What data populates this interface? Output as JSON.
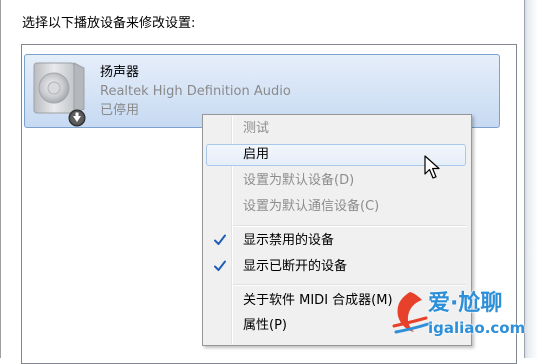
{
  "dialog": {
    "instruction": "选择以下播放设备来修改设置:"
  },
  "device": {
    "icon": "speaker-icon",
    "status_icon": "disabled-arrow-icon",
    "name": "扬声器",
    "description": "Realtek High Definition Audio",
    "status": "已停用"
  },
  "context_menu": {
    "items": [
      {
        "label": "测试",
        "enabled": false,
        "checked": false
      },
      {
        "label": "启用",
        "enabled": true,
        "checked": false,
        "hovered": true
      },
      {
        "label": "设置为默认设备(D)",
        "enabled": false,
        "checked": false
      },
      {
        "label": "设置为默认通信设备(C)",
        "enabled": false,
        "checked": false
      },
      {
        "label": "显示禁用的设备",
        "enabled": true,
        "checked": true
      },
      {
        "label": "显示已断开的设备",
        "enabled": true,
        "checked": true
      },
      {
        "label": "关于软件 MIDI 合成器(M)",
        "enabled": true,
        "checked": false
      },
      {
        "label": "属性(P)",
        "enabled": true,
        "checked": false
      }
    ]
  },
  "watermark": {
    "line1": "爱·尬聊",
    "line2": "igaliao.com"
  },
  "colors": {
    "selection_border": "#7da2ce",
    "menu_background": "#f0f0f0",
    "check_color": "#1f5fb8",
    "watermark_blue": "#2d8fd8"
  }
}
